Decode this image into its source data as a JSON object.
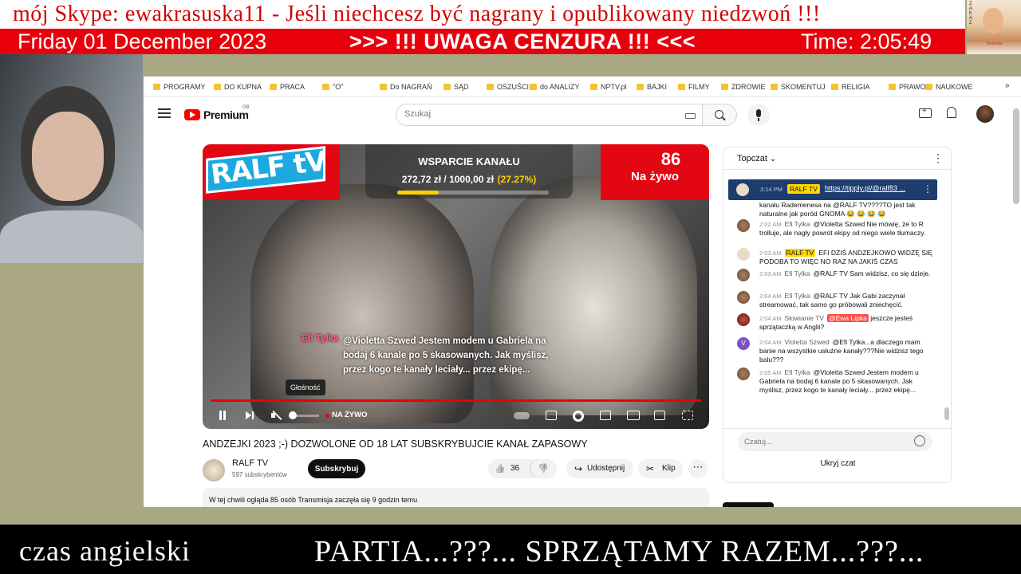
{
  "banner": {
    "line1": "mój Skype: ewakrasuska11  - Jeśli  niechcesz  być  nagrany  i  opublikowany  niedzwoń !!!",
    "date": "Friday 01 December 2023",
    "warning": ">>> !!! UWAGA  CENZURA !!! <<<",
    "time": "Time: 2:05:49",
    "thumb_caption": "Tarantula",
    "thumb_vertical": "ZAKAZ"
  },
  "bookmarks": [
    {
      "label": "PROGRAMY"
    },
    {
      "label": "DO KUPNA"
    },
    {
      "label": "PRACA"
    },
    {
      "label": "\"O\""
    },
    {
      "label": "Do NAGRAŃ"
    },
    {
      "label": "SĄD"
    },
    {
      "label": "OSZUŚCI"
    },
    {
      "label": "do ANALIZY"
    },
    {
      "label": "NPTV.pl"
    },
    {
      "label": "BAJKI"
    },
    {
      "label": "FILMY"
    },
    {
      "label": "ZDROWIE"
    },
    {
      "label": "SKOMENTUJ"
    },
    {
      "label": "RELIGIA"
    },
    {
      "label": "PRAWO"
    },
    {
      "label": "NAUKOWE"
    }
  ],
  "header": {
    "logo_text": "Premium",
    "country_code": "GB",
    "search_placeholder": "Szukaj"
  },
  "player": {
    "channel_logo": "RALF tV",
    "support_title": "WSPARCIE KANAŁU",
    "support_amount": "272,72 zł / 1000,00 zł",
    "support_percent": "(27.27%)",
    "support_progress": 0.2727,
    "viewer_count": "86",
    "live_label": "Na żywo",
    "overlay_author": "Efi Tylka",
    "overlay_message": "@Violetta Szwed Jestem modem u Gabriela na bodaj 6 kanale po 5 skasowanych. Jak myślisz, przez kogo te kanały leciały... przez ekipę...",
    "tooltip": "Głośność",
    "live_status": "NA ŻYWO",
    "volume_level": 0.0
  },
  "video": {
    "title": "ANDZEJKI 2023 ;-) DOZWOLONE OD 18 LAT SUBSKRYBUJCIE KANAŁ ZAPASOWY",
    "channel_name": "RALF TV",
    "subscribers": "597 subskrybentów",
    "subscribe_label": "Subskrybuj",
    "likes": "36",
    "share_label": "Udostępnij",
    "clip_label": "Klip",
    "more_label": "⋯",
    "description": "W tej chwili ogląda 85 osób  Transmisja zaczęła się 9 godzin temu"
  },
  "chat": {
    "mode": "Topczat",
    "menu": "⋮",
    "pinned": {
      "time": "3:14 PM",
      "badge": "RALF TV",
      "link": "https://tipply.pl/@ralf83 ...",
      "menu": "⋮"
    },
    "messages": [
      {
        "time": "",
        "author": "",
        "text": "kanału Rademenesa na @RALF TV????TO jest tak naturalne jak poród GNOMA 😂 😂 😂 😂"
      },
      {
        "time": "2:02 AM",
        "author": "Efi Tylka",
        "text": "@Violetta Szwed Nie mówię, że to R trolluje, ale nagły powrót ekipy od niego wiele tłumaczy."
      },
      {
        "time": "2:03 AM",
        "author": "RALF TV",
        "text": "EFI DZIŚ ANDZEJKOWO WIDZĘ SIĘ PODOBA TO WIĘC NO RAZ NA JAKIŚ CZAS"
      },
      {
        "time": "2:03 AM",
        "author": "Efi Tylka",
        "text": "@RALF TV Sam widzisz, co się dzieje."
      },
      {
        "time": "2:04 AM",
        "author": "Efi Tylka",
        "text": "@RALF TV Jak Gabi zaczynał streamować, tak samo go próbowali zniechęcić."
      },
      {
        "time": "2:04 AM",
        "author": "Słowianie TV",
        "mention": "@Ewa Lipka",
        "text": "jeszcze jesteś sprzątaczką w Anglii?"
      },
      {
        "time": "2:04 AM",
        "author": "Violetta Szwed",
        "text": "@Efi Tylka...a dlaczego mam banie na wszystkie usłużne kanały???Nie widzisz tego balu???"
      },
      {
        "time": "2:05 AM",
        "author": "Efi Tylka",
        "text": "@Violetta Szwed Jestem modem u Gabriela na bodaj 6 kanale po 5 skasowanych. Jak myślisz, przez kogo te kanały leciały... przez ekipę..."
      }
    ],
    "input_placeholder": "Czatuj...",
    "hide_label": "Ukryj czat"
  },
  "bottom": {
    "left": "czas  angielski",
    "right": "PARTIA...???...  SPRZĄTAMY  RAZEM...???..."
  },
  "colors": {
    "banner_red": "#e8000d",
    "youtube_red": "#ff0000",
    "badge_yellow": "#ffd600",
    "pinned_blue": "#1c3d6e"
  }
}
